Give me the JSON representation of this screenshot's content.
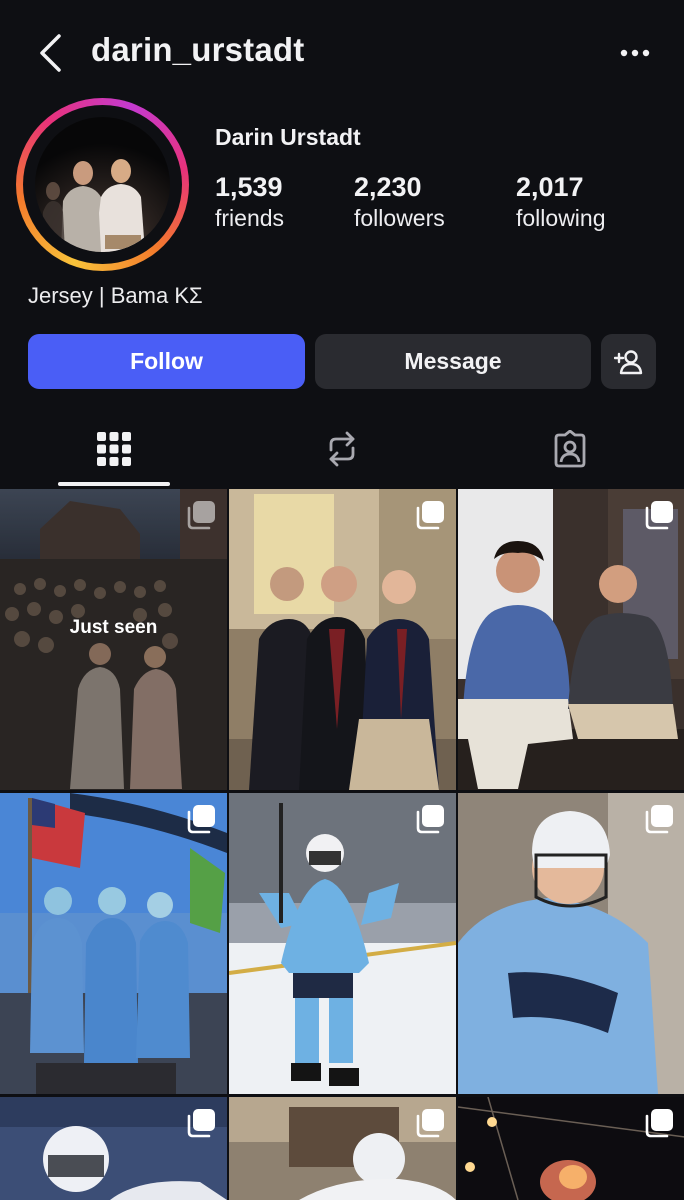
{
  "header": {
    "username": "darin_urstadt",
    "back_icon": "chevron-left-icon",
    "more_icon": "more-horizontal-icon"
  },
  "profile": {
    "display_name": "Darin Urstadt",
    "stats": {
      "friends": {
        "value": "1,539",
        "label": "friends"
      },
      "followers": {
        "value": "2,230",
        "label": "followers"
      },
      "following": {
        "value": "2,017",
        "label": "following"
      }
    },
    "bio": "Jersey | Bama ΚΣ"
  },
  "actions": {
    "follow": "Follow",
    "message": "Message",
    "add_friend_icon": "add-user-icon"
  },
  "tabs": [
    {
      "name": "posts-grid",
      "icon": "grid-icon",
      "active": true
    },
    {
      "name": "reposts",
      "icon": "repost-icon",
      "active": false
    },
    {
      "name": "tagged",
      "icon": "tagged-person-icon",
      "active": false
    }
  ],
  "grid": {
    "posts": [
      {
        "badge": "Just seen",
        "multi": true
      },
      {
        "multi": true
      },
      {
        "multi": true
      },
      {
        "multi": true
      },
      {
        "multi": true
      },
      {
        "multi": true
      },
      {
        "multi": true
      },
      {
        "multi": true
      },
      {
        "multi": true
      }
    ]
  },
  "colors": {
    "background": "#0e0f13",
    "follow_button": "#4a5ef6",
    "secondary_button": "#2a2b30",
    "story_ring": [
      "#f8c23a",
      "#e8327a",
      "#c43ad0"
    ]
  }
}
